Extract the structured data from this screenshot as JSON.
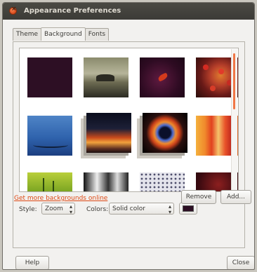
{
  "window": {
    "title": "Appearance Preferences"
  },
  "tabs": [
    {
      "label": "Theme",
      "active": false
    },
    {
      "label": "Background",
      "active": true
    },
    {
      "label": "Fonts",
      "active": false
    }
  ],
  "gallery": {
    "selected_index": 0,
    "scroll_position": 0.0
  },
  "controls": {
    "style_label": "Style:",
    "style_value": "Zoom",
    "colors_label": "Colors:",
    "colors_value": "Solid color",
    "color_swatch": "#2d0f24"
  },
  "actions": {
    "more_link": "Get more backgrounds online",
    "remove_label": "Remove",
    "add_label": "Add..."
  },
  "footer": {
    "help_label": "Help",
    "close_label": "Close"
  },
  "colors": {
    "accent": "#dd4814",
    "titlebar": "#3c3b37",
    "window_bg": "#f2f1ef"
  }
}
